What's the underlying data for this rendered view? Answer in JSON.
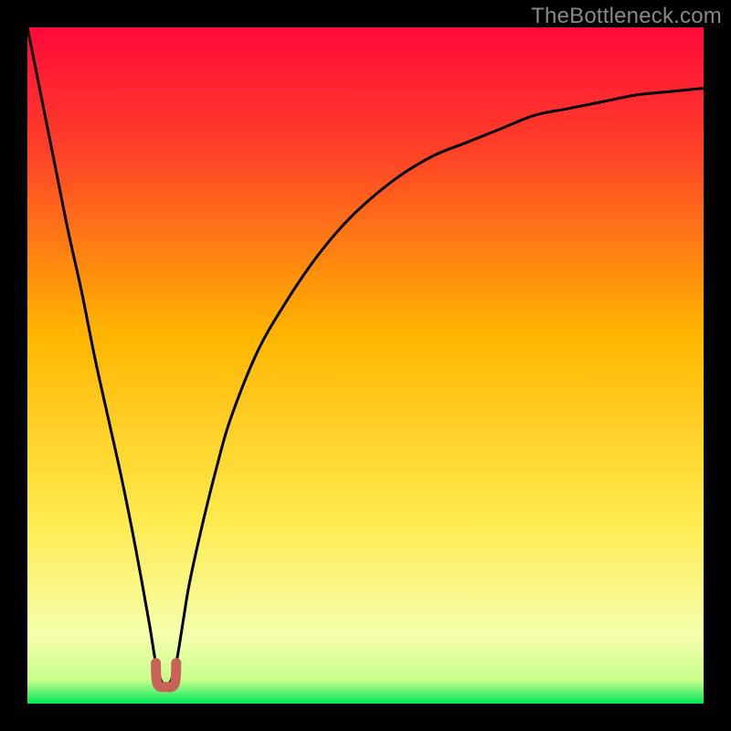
{
  "watermark": "TheBottleneck.com",
  "colors": {
    "bg_black": "#000000",
    "grad_top": "#ff0a3a",
    "grad_upper": "#ff4a1f",
    "grad_mid": "#ffb400",
    "grad_lower": "#ffe94a",
    "grad_pale": "#f6ffad",
    "grad_green": "#00e85b",
    "curve": "#000000",
    "marker_fill": "#c76259",
    "marker_stroke": "#b24f47"
  },
  "chart_data": {
    "type": "line",
    "title": "",
    "xlabel": "",
    "ylabel": "",
    "xlim": [
      0,
      100
    ],
    "ylim": [
      0,
      100
    ],
    "series": [
      {
        "name": "bottleneck-curve",
        "x": [
          0,
          2,
          4,
          6,
          8,
          10,
          12,
          14,
          16,
          18,
          19,
          20,
          21,
          22,
          23,
          24,
          26,
          28,
          30,
          34,
          38,
          42,
          46,
          50,
          55,
          60,
          65,
          70,
          75,
          80,
          85,
          90,
          95,
          100
        ],
        "y": [
          100,
          90,
          80,
          70,
          61,
          51,
          42,
          33,
          23,
          12,
          6,
          3,
          3,
          6,
          12,
          18,
          27,
          35,
          42,
          52,
          59,
          65,
          70,
          74,
          78,
          81,
          83,
          85,
          87,
          88,
          89,
          90,
          90.5,
          91
        ]
      }
    ],
    "optimum_marker": {
      "x_range": [
        19,
        22
      ],
      "y": 3
    },
    "gradient_stops": [
      {
        "offset": 0.0,
        "color": "#ff0a3a"
      },
      {
        "offset": 0.18,
        "color": "#ff4029"
      },
      {
        "offset": 0.45,
        "color": "#ffb400"
      },
      {
        "offset": 0.72,
        "color": "#ffe94a"
      },
      {
        "offset": 0.9,
        "color": "#f6ffad"
      },
      {
        "offset": 0.965,
        "color": "#c7ff8a"
      },
      {
        "offset": 1.0,
        "color": "#00e85b"
      }
    ]
  }
}
